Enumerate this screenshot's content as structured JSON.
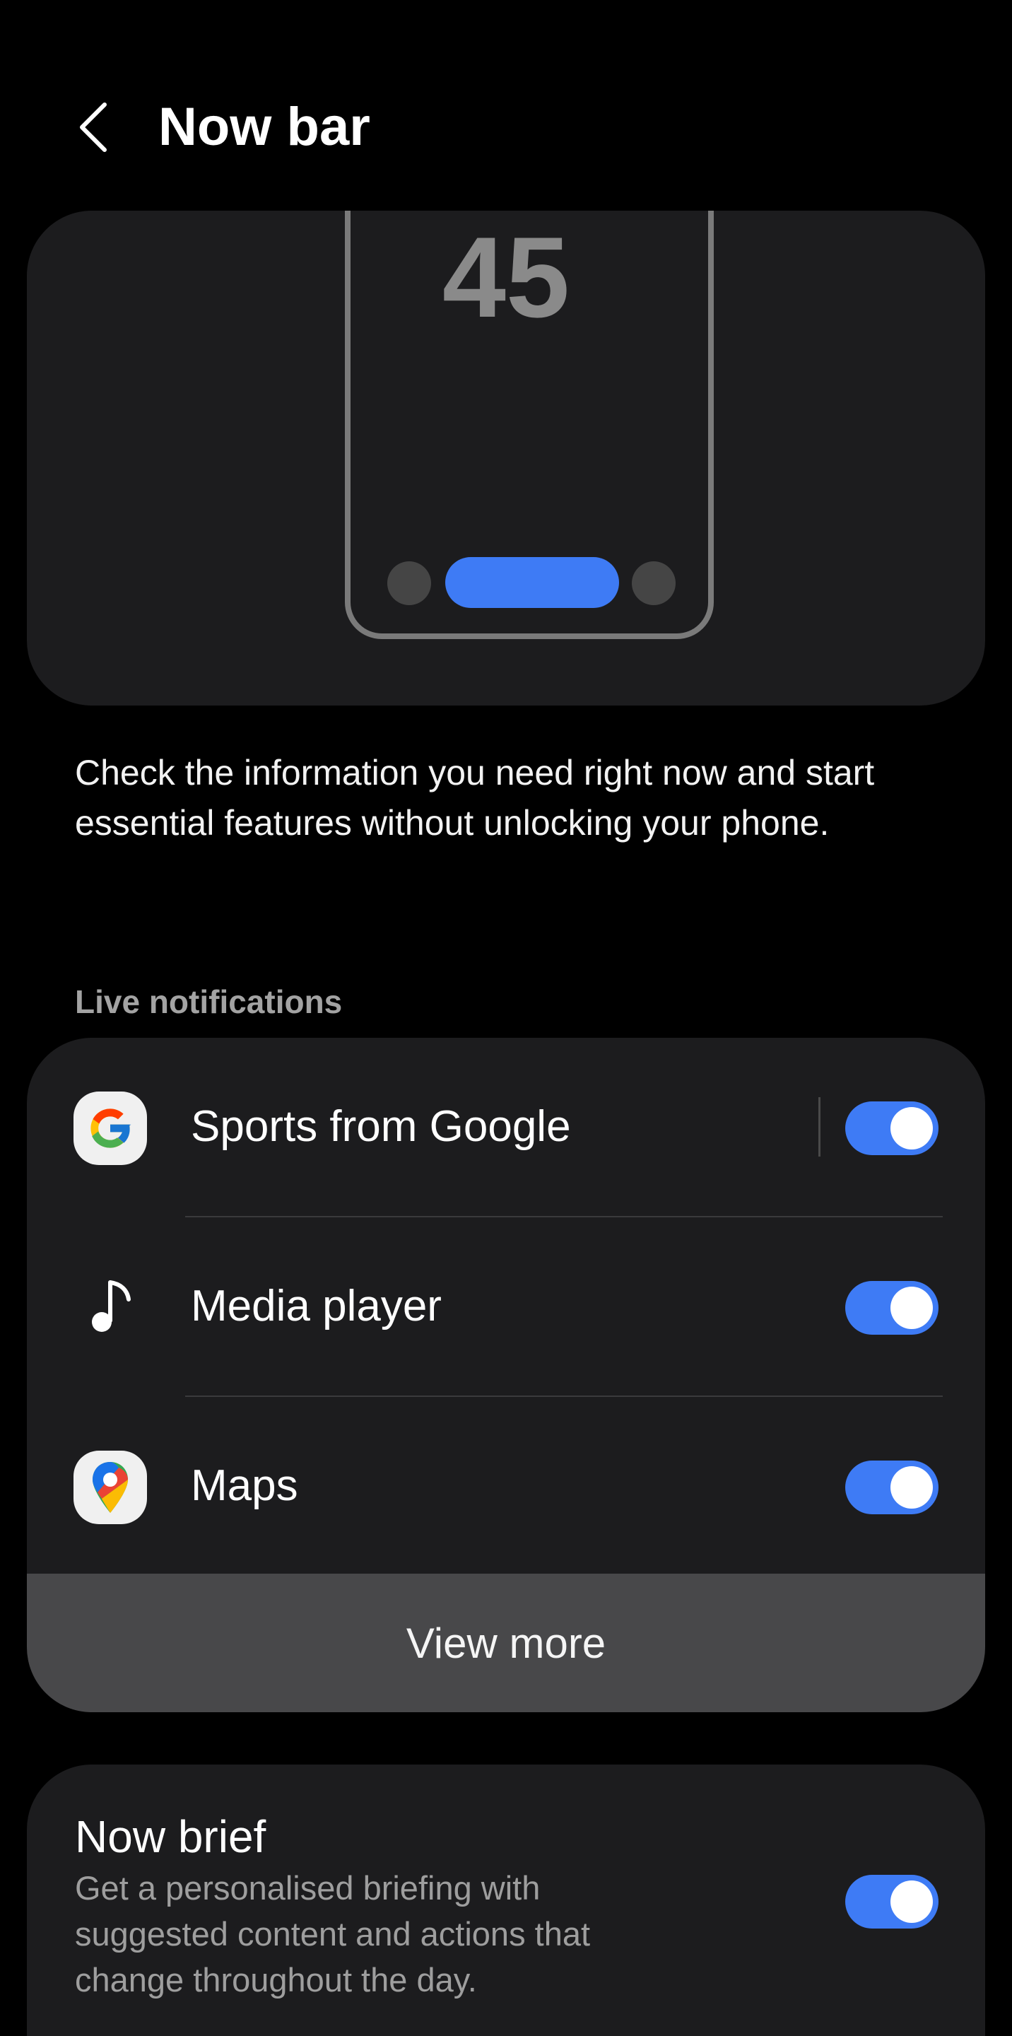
{
  "header": {
    "back_icon": "chevron-left-icon",
    "title": "Now bar"
  },
  "illustration": {
    "clock": "45",
    "nowbar_color": "#3e7bf5"
  },
  "description": "Check the information you need right now and start essential features without unlocking your phone.",
  "live_notifications": {
    "section_title": "Live notifications",
    "items": [
      {
        "label": "Sports from Google",
        "icon": "google-g-icon",
        "enabled": true
      },
      {
        "label": "Media player",
        "icon": "music-note-icon",
        "enabled": true
      },
      {
        "label": "Maps",
        "icon": "google-maps-icon",
        "enabled": true
      }
    ],
    "view_more_label": "View more"
  },
  "now_brief": {
    "title": "Now brief",
    "description": "Get a personalised briefing with suggested content and actions that change throughout the day.",
    "enabled": true
  },
  "colors": {
    "background": "#000000",
    "card": "#1c1c1e",
    "accent": "#3e7bf5",
    "view_more_bg": "#48484a"
  }
}
